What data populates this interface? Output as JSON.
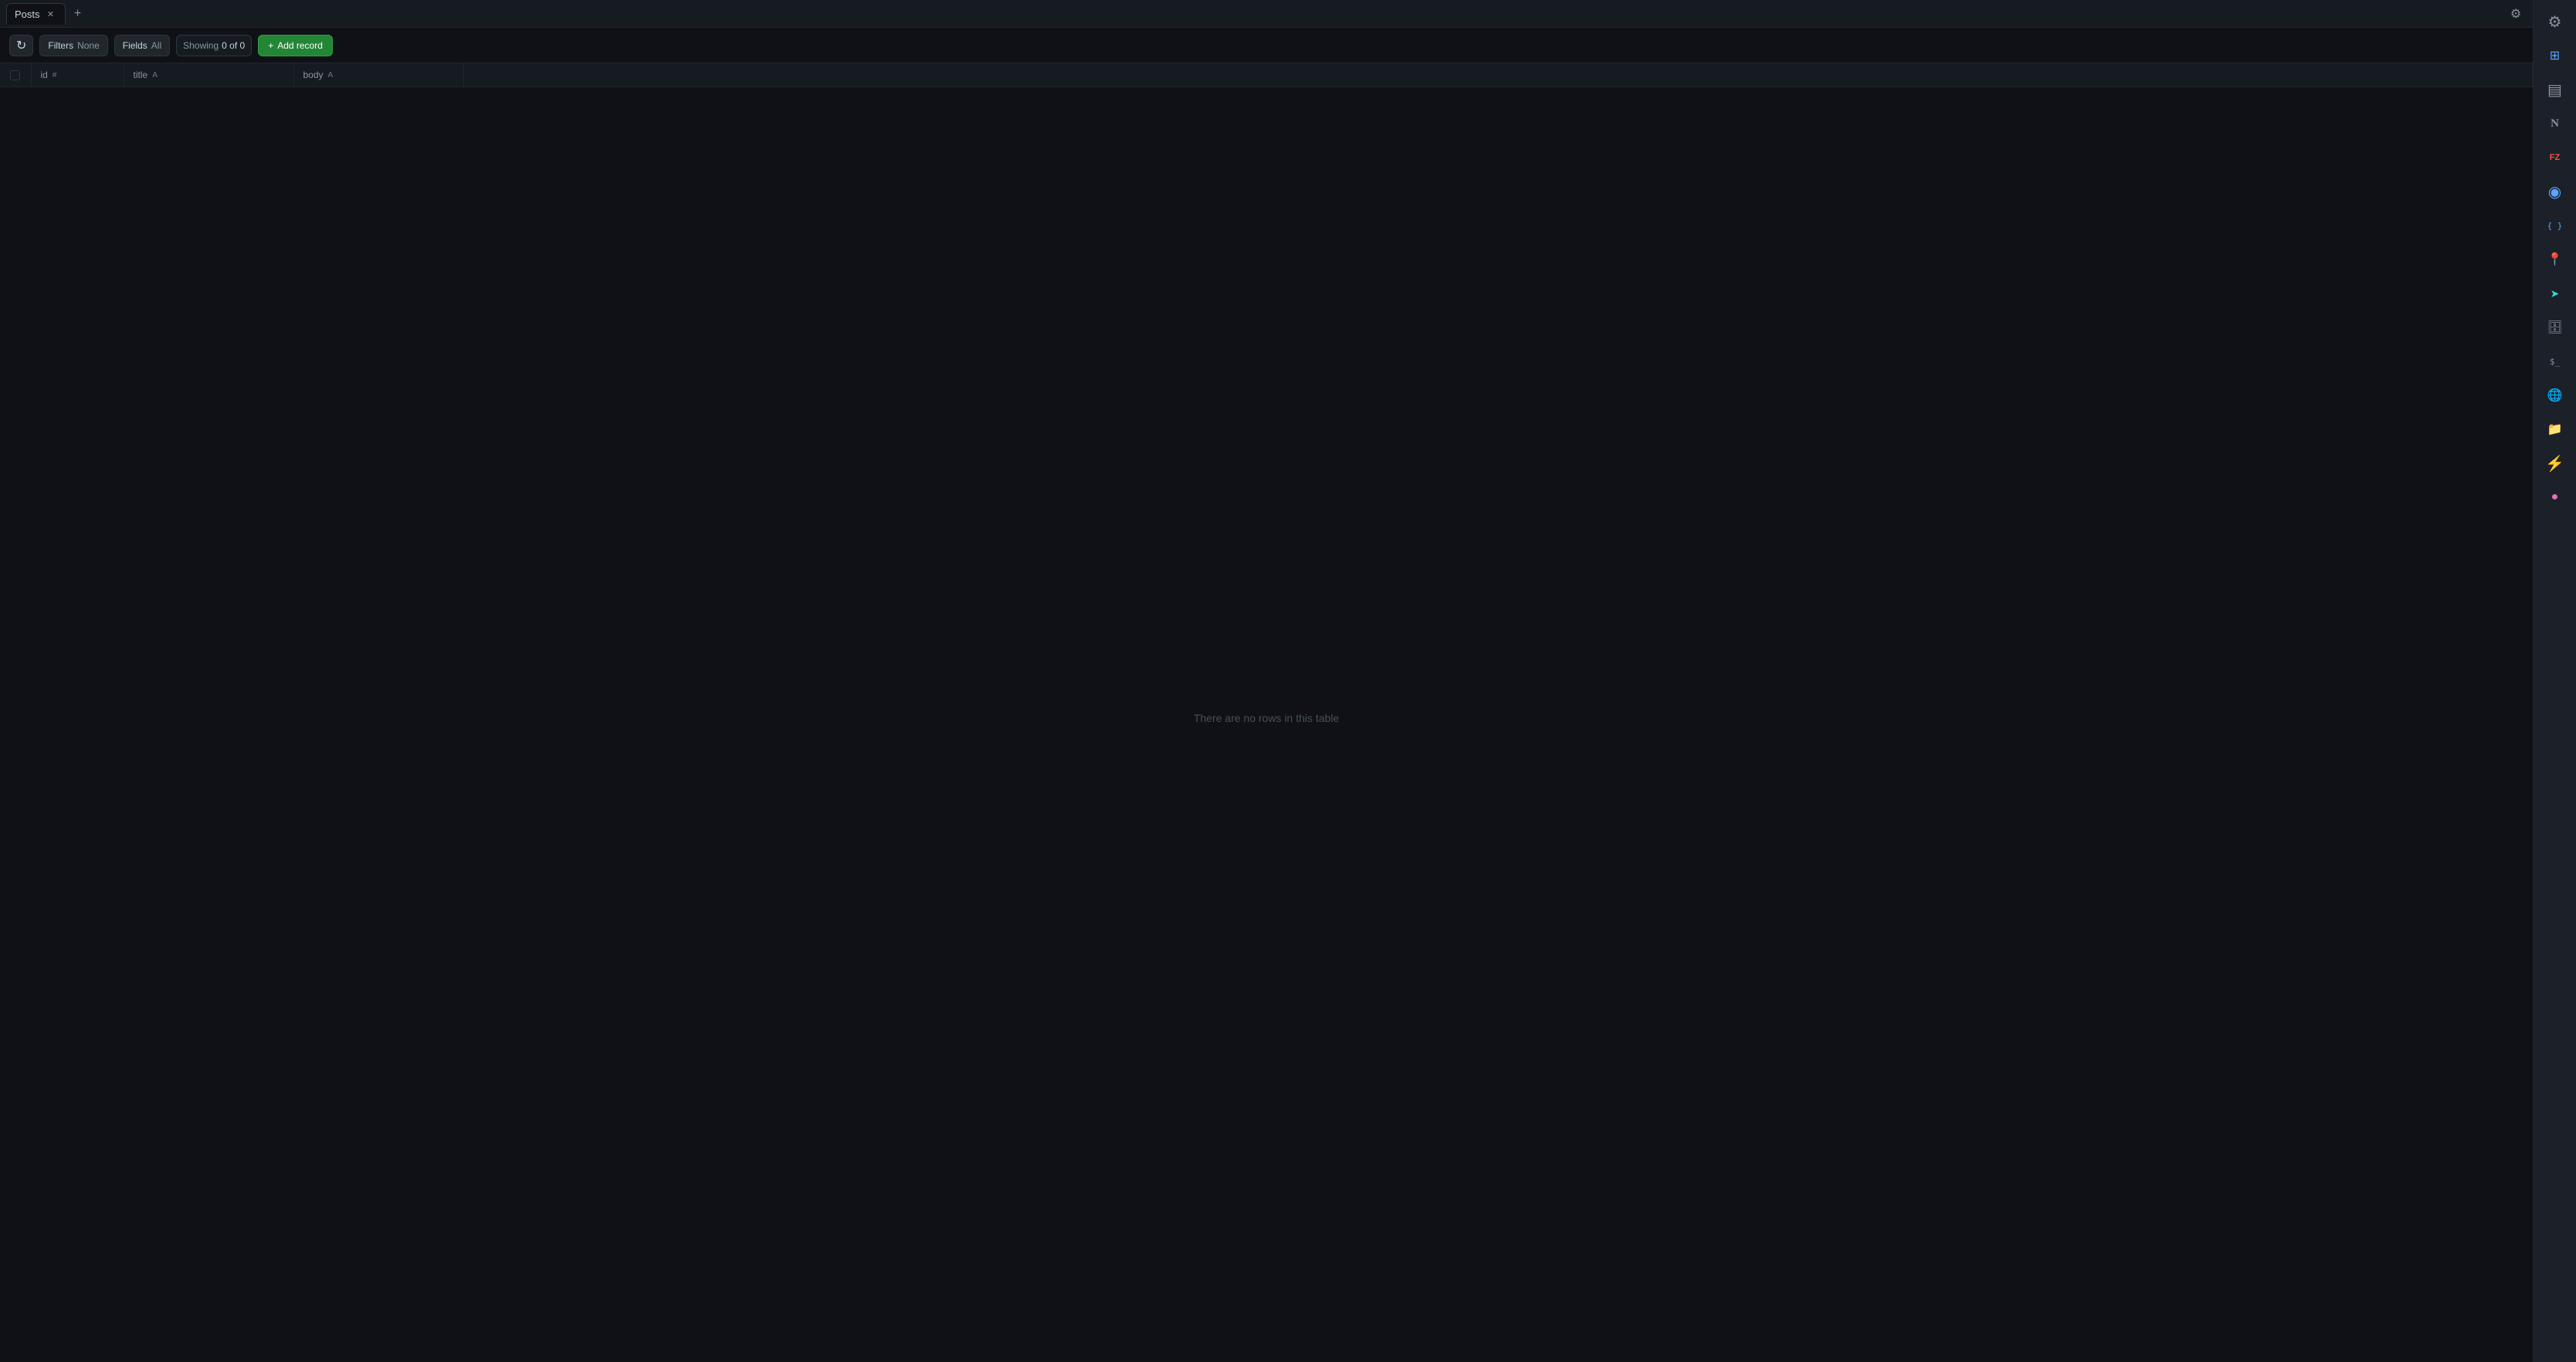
{
  "tabs": [
    {
      "id": "posts-tab",
      "label": "Posts",
      "active": true,
      "closeable": true
    }
  ],
  "tab_add_label": "+",
  "toolbar": {
    "refresh_label": "↻",
    "filters_label": "Filters",
    "filters_value": "None",
    "fields_label": "Fields",
    "fields_value": "All",
    "showing_label": "Showing",
    "showing_count": "0 of 0",
    "add_record_label": "Add record"
  },
  "table": {
    "columns": [
      {
        "id": "checkbox-col",
        "label": "",
        "type": ""
      },
      {
        "id": "id-col",
        "label": "id",
        "type": "#",
        "sort": ""
      },
      {
        "id": "title-col",
        "label": "title",
        "type": "A",
        "sort": ""
      },
      {
        "id": "body-col",
        "label": "body",
        "type": "A",
        "sort": ""
      }
    ],
    "rows": [],
    "empty_message": "There are no rows in this table"
  },
  "settings": {
    "icon": "⚙"
  },
  "dock": {
    "items": [
      {
        "id": "dock-settings",
        "icon": "gear",
        "label": "Settings",
        "color": "app-gray",
        "unicode": "⚙"
      },
      {
        "id": "dock-grid",
        "icon": "grid",
        "label": "Grid",
        "color": "app-blue",
        "unicode": "⊞"
      },
      {
        "id": "dock-layers",
        "icon": "layers",
        "label": "Layers",
        "color": "app-gray",
        "unicode": "▤"
      },
      {
        "id": "dock-notion",
        "icon": "n",
        "label": "Notion",
        "color": "app-gray",
        "unicode": "N"
      },
      {
        "id": "dock-filezilla",
        "icon": "filezilla",
        "label": "FileZilla",
        "color": "app-red",
        "unicode": "FZ"
      },
      {
        "id": "dock-chrome",
        "icon": "chrome",
        "label": "Chrome",
        "color": "app-blue",
        "unicode": "◉"
      },
      {
        "id": "dock-vscode",
        "icon": "vscode",
        "label": "VS Code",
        "color": "app-blue",
        "unicode": "{ }"
      },
      {
        "id": "dock-maps",
        "icon": "maps",
        "label": "Maps",
        "color": "app-green",
        "unicode": "📍"
      },
      {
        "id": "dock-arrow",
        "icon": "arrow",
        "label": "Arrow",
        "color": "app-cyan",
        "unicode": "➤"
      },
      {
        "id": "dock-db",
        "icon": "database",
        "label": "Database",
        "color": "app-gray",
        "unicode": "🗄"
      },
      {
        "id": "dock-terminal",
        "icon": "terminal",
        "label": "Terminal",
        "color": "app-gray",
        "unicode": ">_"
      },
      {
        "id": "dock-globe",
        "icon": "globe",
        "label": "Globe",
        "color": "app-blue",
        "unicode": "🌐"
      },
      {
        "id": "dock-folder",
        "icon": "folder",
        "label": "Folder",
        "color": "app-gray",
        "unicode": "📁"
      },
      {
        "id": "dock-bolt",
        "icon": "bolt",
        "label": "Bolt",
        "color": "app-yellow",
        "unicode": "⚡"
      },
      {
        "id": "dock-extra",
        "icon": "extra",
        "label": "Extra",
        "color": "app-pink",
        "unicode": "●"
      }
    ]
  }
}
